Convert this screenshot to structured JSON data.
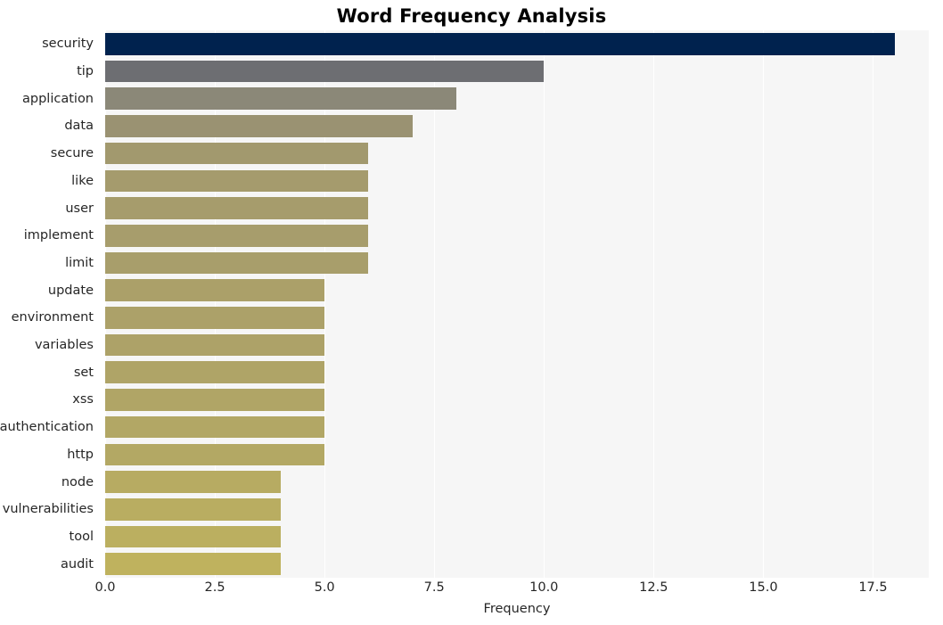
{
  "chart_data": {
    "type": "bar",
    "orientation": "horizontal",
    "title": "Word Frequency Analysis",
    "xlabel": "Frequency",
    "ylabel": "",
    "xlim": [
      0,
      18.77
    ],
    "xticks": [
      0.0,
      2.5,
      5.0,
      7.5,
      10.0,
      12.5,
      15.0,
      17.5
    ],
    "xticklabels": [
      "0.0",
      "2.5",
      "5.0",
      "7.5",
      "10.0",
      "12.5",
      "15.0",
      "17.5"
    ],
    "grid": "vertical-white-on-light-gray",
    "legend": "none",
    "colormap": "cividis",
    "categories": [
      "security",
      "tip",
      "application",
      "data",
      "secure",
      "like",
      "user",
      "implement",
      "limit",
      "update",
      "environment",
      "variables",
      "set",
      "xss",
      "authentication",
      "http",
      "node",
      "vulnerabilities",
      "tool",
      "audit"
    ],
    "values": [
      18,
      10,
      8,
      7,
      6,
      6,
      6,
      6,
      6,
      5,
      5,
      5,
      5,
      5,
      5,
      5,
      4,
      4,
      4,
      4
    ],
    "bar_colors": [
      "#00224e",
      "#6d6e72",
      "#8b8878",
      "#9a9272",
      "#a2996e",
      "#a59b6d",
      "#a69c6c",
      "#a79d6c",
      "#a89e6b",
      "#ab a0 69",
      "#aca169",
      "#ada268",
      "#afa467",
      "#b0a566",
      "#b2a765",
      "#b3a864",
      "#b7ab62",
      "#b9ad61",
      "#bbaf60",
      "#bfb25e"
    ],
    "background": "#f6f6f6",
    "figure_background": "#ffffff"
  }
}
